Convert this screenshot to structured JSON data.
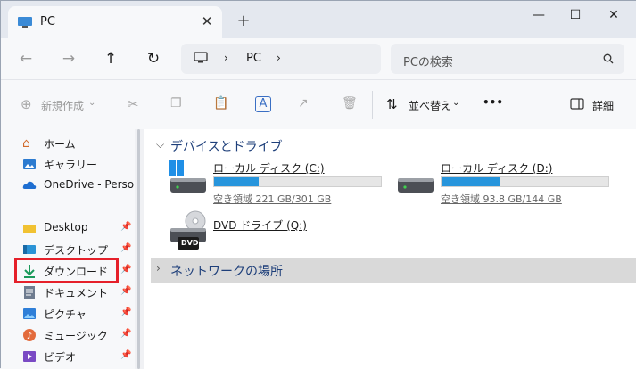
{
  "tab": {
    "title": "PC"
  },
  "address": {
    "path_segment": "PC"
  },
  "search": {
    "placeholder": "PCの検索"
  },
  "commands": {
    "new": "新規作成",
    "sort": "並べ替え",
    "more": "•••",
    "details": "詳細"
  },
  "sidebar": {
    "items": [
      {
        "label": "ホーム",
        "icon": "home-icon"
      },
      {
        "label": "ギャラリー",
        "icon": "gallery-icon"
      },
      {
        "label": "OneDrive - Persona",
        "icon": "cloud-icon"
      },
      {
        "label": "Desktop",
        "icon": "folder-icon"
      },
      {
        "label": "デスクトップ",
        "icon": "desktop-icon"
      },
      {
        "label": "ダウンロード",
        "icon": "download-icon"
      },
      {
        "label": "ドキュメント",
        "icon": "document-icon"
      },
      {
        "label": "ピクチャ",
        "icon": "pictures-icon"
      },
      {
        "label": "ミュージック",
        "icon": "music-icon"
      },
      {
        "label": "ビデオ",
        "icon": "video-icon"
      }
    ]
  },
  "main": {
    "devices_header": "デバイスとドライブ",
    "network_header": "ネットワークの場所",
    "drives": [
      {
        "name": "ローカル ディスク (C:)",
        "free": "空き領域 221 GB/301 GB",
        "used_fraction": 0.27
      },
      {
        "name": "ローカル ディスク (D:)",
        "free": "空き領域 93.8 GB/144 GB",
        "used_fraction": 0.35
      },
      {
        "name": "DVD ドライブ (Q:)",
        "dvd_label": "DVD"
      }
    ]
  },
  "colors": {
    "accent": "#2795dc",
    "highlight": "#e5202a"
  }
}
